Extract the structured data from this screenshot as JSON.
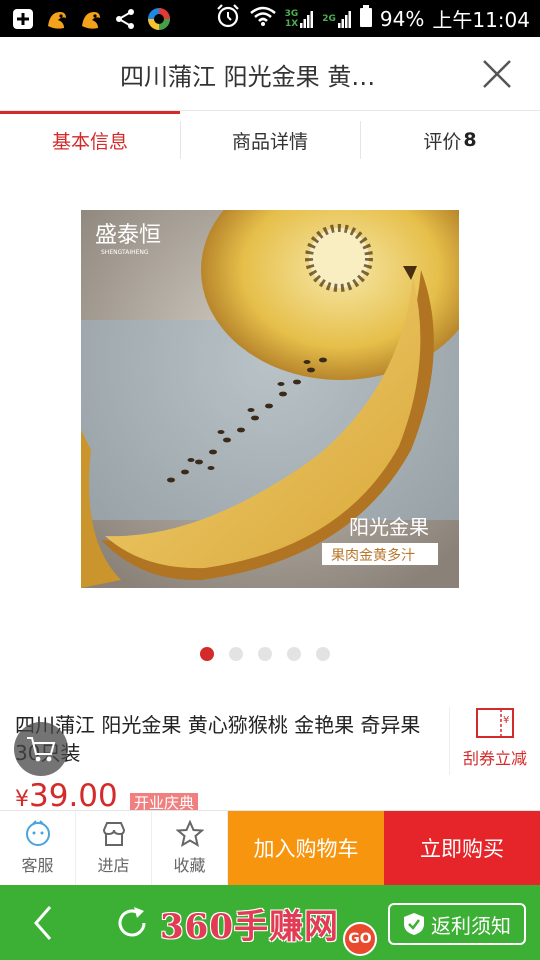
{
  "status_bar": {
    "network_1": "3G",
    "network_1_sub": "1X",
    "network_2": "2G",
    "battery": "94%",
    "time": "上午11:04"
  },
  "header": {
    "title": "四川蒲江 阳光金果 黄…"
  },
  "tabs": [
    {
      "label": "基本信息"
    },
    {
      "label": "商品详情"
    },
    {
      "label": "评价",
      "count": "8"
    }
  ],
  "gallery": {
    "brand": "盛泰恒",
    "brand_pinyin": "SHENGTAIHENG",
    "caption_title": "阳光金果",
    "caption_sub": "果肉金黄多汁",
    "dot_count": 5,
    "active_index": 0
  },
  "product": {
    "name": "四川蒲江 阳光金果 黄心猕猴桃 金艳果 奇异果30只装",
    "price_symbol": "¥",
    "price": "39.00",
    "badge": "开业庆典"
  },
  "coupon": {
    "label": "刮券立减",
    "icon_text": "¥"
  },
  "bottom_bar": {
    "service": "客服",
    "store": "进店",
    "favorite": "收藏",
    "add_to_cart": "加入购物车",
    "buy_now": "立即购买"
  },
  "browser_bar": {
    "watermark": "360手赚网",
    "go": "GO",
    "rebate": "返利须知"
  },
  "colors": {
    "accent_red": "#d42a2a",
    "cart_orange": "#f8950f",
    "buy_red": "#e5252a",
    "browser_green": "#3cb035"
  }
}
